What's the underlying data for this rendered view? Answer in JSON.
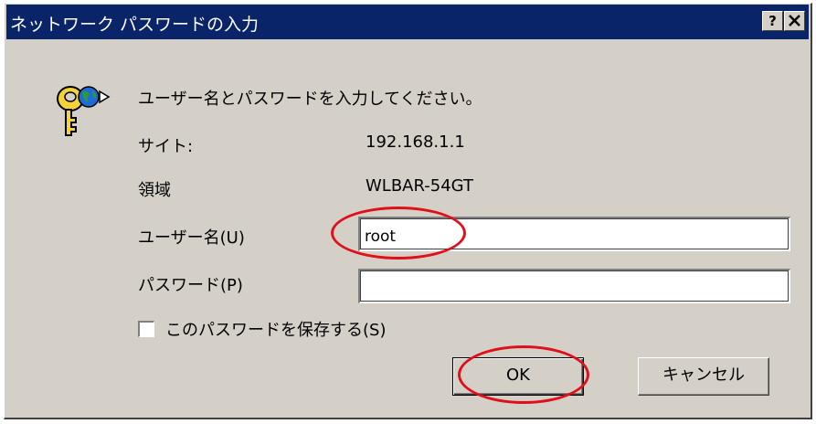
{
  "window": {
    "title": "ネットワーク パスワードの入力",
    "help_label": "?",
    "close_label": "✕"
  },
  "icon": "key-globe-icon",
  "instruction": "ユーザー名とパスワードを入力してください。",
  "site": {
    "label": "サイト:",
    "value": "192.168.1.1"
  },
  "realm": {
    "label": "領域",
    "value": "WLBAR-54GT"
  },
  "username": {
    "label": "ユーザー名(U)",
    "value": "root"
  },
  "password": {
    "label": "パスワード(P)",
    "value": ""
  },
  "save_password": {
    "label": "このパスワードを保存する(S)",
    "checked": false
  },
  "buttons": {
    "ok": "OK",
    "cancel": "キャンセル"
  },
  "colors": {
    "titlebar": "#0a246a",
    "dialog": "#d4d0c8",
    "annotation": "#e0101a"
  }
}
